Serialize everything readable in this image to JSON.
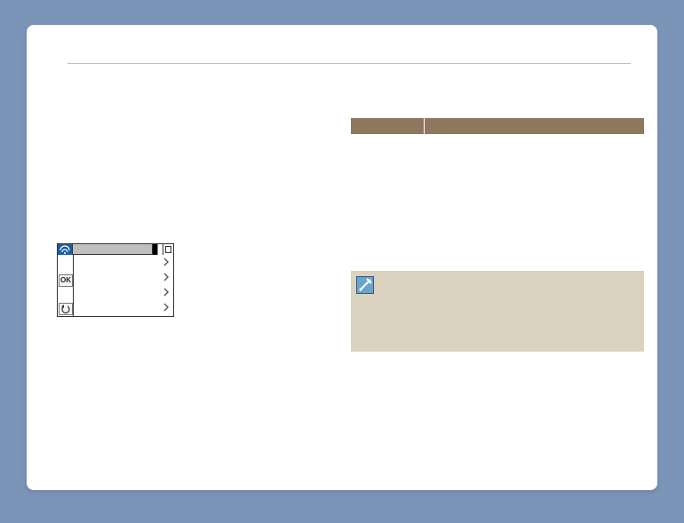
{
  "table_header": {
    "col_a": "",
    "col_b": ""
  },
  "device": {
    "ok_label": "OK"
  },
  "note": {
    "text": ""
  }
}
